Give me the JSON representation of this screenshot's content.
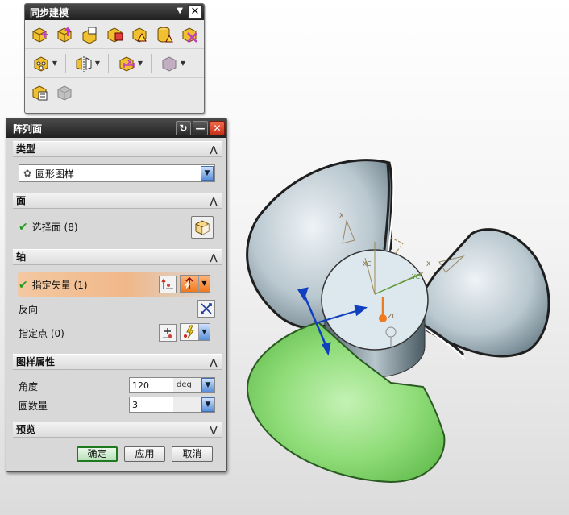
{
  "toolbar": {
    "title": "同步建模",
    "row1_icons": [
      "move-face-icon",
      "pull-face-icon",
      "offset-region-icon",
      "replace-face-icon",
      "resize-blend-icon",
      "resize-face-icon",
      "delete-face-icon"
    ],
    "row2_icons": [
      "pattern-face-icon",
      "mirror-face-icon",
      "constrain-face-icon",
      "shell-body-icon"
    ],
    "row3_icons": [
      "cross-section-edit-icon",
      "local-scale-icon"
    ]
  },
  "dialog": {
    "title": "阵列面",
    "sections": {
      "type": {
        "label": "类型",
        "combo_value": "圆形图样"
      },
      "face": {
        "label": "面",
        "select_face": "选择面 (8)"
      },
      "axis": {
        "label": "轴",
        "specify_vector": "指定矢量 (1)",
        "reverse": "反向",
        "specify_point": "指定点 (0)"
      },
      "pattern_props": {
        "label": "图样属性",
        "angle_label": "角度",
        "angle_value": "120",
        "angle_unit": "deg",
        "count_label": "圆数量",
        "count_value": "3"
      },
      "preview": {
        "label": "预览"
      }
    },
    "buttons": {
      "ok": "确定",
      "apply": "应用",
      "cancel": "取消"
    }
  },
  "viewport": {
    "labels": {
      "x1": "X",
      "xc": "XC",
      "zc": "ZC",
      "yc": "YC",
      "x2": "X"
    },
    "colors": {
      "blade": "#b8c6cf",
      "preview_blade": "#7ccf6a",
      "hub": "#dde8ee"
    }
  }
}
